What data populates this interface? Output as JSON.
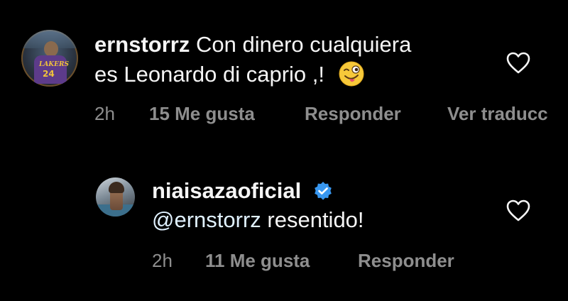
{
  "comments": [
    {
      "username": "ernstorrz",
      "text_line1": "Con dinero cualquiera",
      "text_line2": "es Leonardo di caprio ,!",
      "avatar_text": "LAKERS",
      "avatar_number": "24",
      "emoji": "winking-face-with-tongue",
      "time": "2h",
      "likes": "15 Me gusta",
      "reply": "Responder",
      "translate": "Ver traducc"
    },
    {
      "username": "niaisazaoficial",
      "verified": true,
      "mention": "@ernstorrz",
      "text": " resentido!",
      "time": "2h",
      "likes": "11 Me gusta",
      "reply": "Responder"
    }
  ],
  "colors": {
    "background": "#000000",
    "text": "#f5f5f5",
    "meta": "#8e8e8e",
    "verified": "#3897f0",
    "mention": "#e0f1ff"
  },
  "icons": [
    "heart-icon",
    "verified-badge-icon",
    "winking-face-with-tongue-emoji"
  ]
}
